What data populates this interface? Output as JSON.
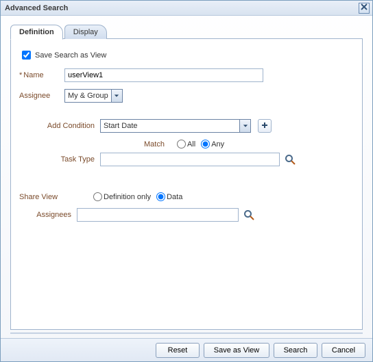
{
  "title": "Advanced Search",
  "tabs": {
    "definition": "Definition",
    "display": "Display"
  },
  "save_as_view": {
    "label": "Save Search as View",
    "checked": true
  },
  "name": {
    "label": "Name",
    "required_marker": "*",
    "value": "userView1"
  },
  "assignee": {
    "label": "Assignee",
    "selected": "My & Group"
  },
  "add_condition": {
    "label": "Add Condition",
    "selected": "Start Date"
  },
  "match": {
    "label": "Match",
    "all": "All",
    "any": "Any",
    "selected": "any"
  },
  "task_type": {
    "label": "Task Type",
    "value": ""
  },
  "share_view": {
    "label": "Share View",
    "definition_only": "Definition only",
    "data": "Data",
    "selected": "data"
  },
  "assignees": {
    "label": "Assignees",
    "value": ""
  },
  "buttons": {
    "reset": "Reset",
    "save_as_view": "Save as View",
    "search": "Search",
    "cancel": "Cancel"
  }
}
